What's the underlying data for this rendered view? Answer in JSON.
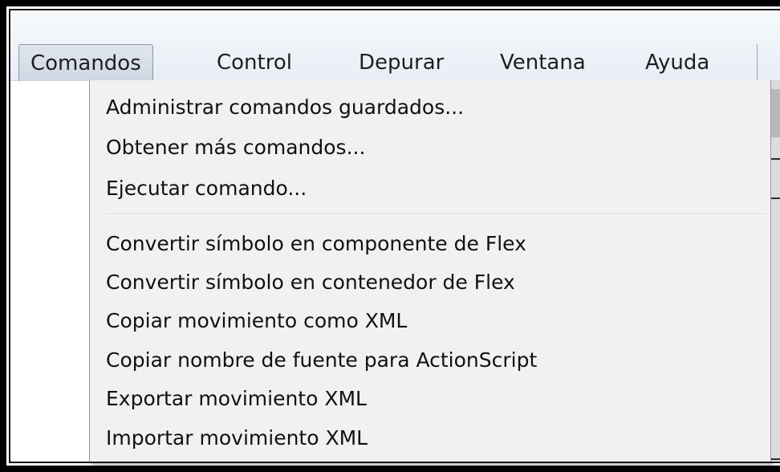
{
  "menubar": {
    "items": [
      {
        "label": "Comandos",
        "active": true
      },
      {
        "label": "Control",
        "active": false
      },
      {
        "label": "Depurar",
        "active": false
      },
      {
        "label": "Ventana",
        "active": false
      },
      {
        "label": "Ayuda",
        "active": false
      }
    ]
  },
  "dropdown": {
    "group1": [
      {
        "label": "Administrar comandos guardados..."
      },
      {
        "label": "Obtener más comandos..."
      },
      {
        "label": "Ejecutar comando..."
      }
    ],
    "group2": [
      {
        "label": "Convertir símbolo en componente de Flex"
      },
      {
        "label": "Convertir símbolo en contenedor de Flex"
      },
      {
        "label": "Copiar movimiento como XML"
      },
      {
        "label": "Copiar nombre de fuente para ActionScript"
      },
      {
        "label": "Exportar movimiento XML"
      },
      {
        "label": "Importar movimiento XML"
      }
    ]
  },
  "colors": {
    "menu_bg": "#f1f1f1",
    "text": "#111111",
    "frame": "#000000"
  }
}
